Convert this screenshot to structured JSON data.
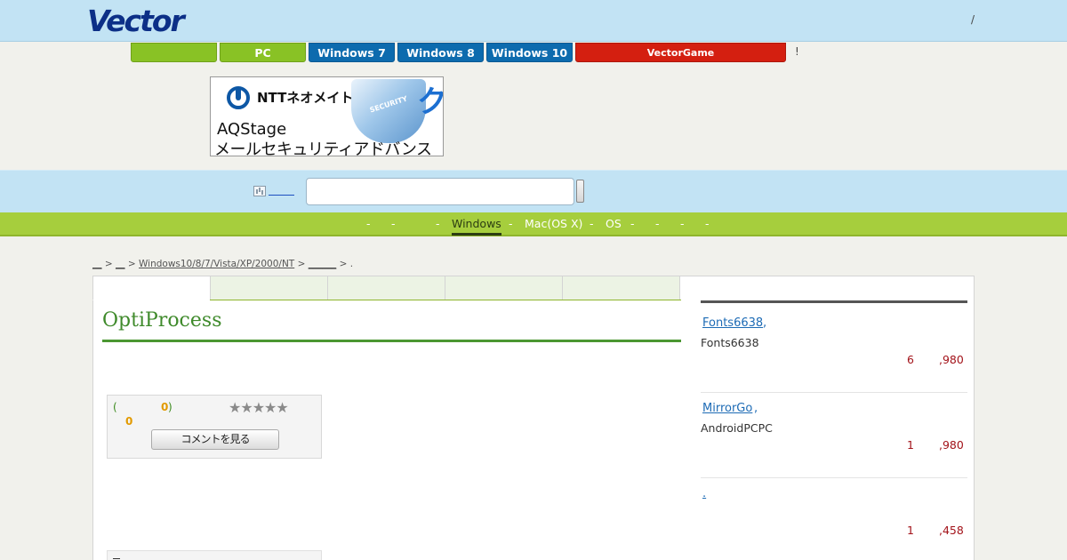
{
  "header": {
    "logo": "Vector",
    "right_link": "/"
  },
  "categories": [
    {
      "label": "",
      "style": "green"
    },
    {
      "label": "PC",
      "style": "green"
    },
    {
      "label": "Windows 7",
      "style": "blue"
    },
    {
      "label": "Windows 8",
      "style": "blue"
    },
    {
      "label": "Windows 10",
      "style": "blue"
    },
    {
      "label": "VectorGame",
      "style": "red"
    }
  ],
  "categories_trailing": "!",
  "banner": {
    "brand": "NTTネオメイト",
    "badge": "SECURITY",
    "katakana": "ク",
    "line1": "AQStage",
    "line2": "メールセキュリティアドバンス"
  },
  "search": {
    "placeholder": "",
    "value": ""
  },
  "nav": {
    "items": [
      "-",
      "-",
      "-",
      "Windows",
      "-",
      "Mac(OS X)",
      "-",
      "OS",
      "-",
      "-",
      "-",
      "-"
    ],
    "active": "Windows"
  },
  "breadcrumb": {
    "sep": ">",
    "crumbs": [
      "__",
      "__",
      "Windows10/8/7/Vista/XP/2000/NT",
      "______"
    ],
    "tail": "."
  },
  "software": {
    "title": "OptiProcess",
    "review_paren_open": "(",
    "review_count": "0",
    "review_paren_close": ")",
    "score": "0",
    "stars": "★★★★★",
    "comment_button": "コメントを見る"
  },
  "ranking": [
    {
      "name": "Fonts6638",
      "suffix": ",",
      "desc": "Fonts6638",
      "num": "6",
      "price": ",980"
    },
    {
      "name": "MirrorGo ",
      "suffix": ",",
      "desc": "AndroidPCPC",
      "num": "1",
      "price": ",980"
    },
    {
      "name": ".",
      "suffix": "",
      "desc": "",
      "num": "1",
      "price": ",458"
    }
  ]
}
